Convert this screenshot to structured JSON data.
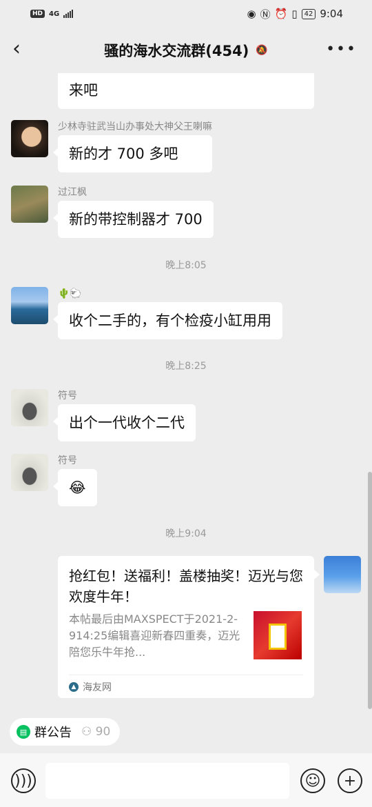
{
  "status_bar": {
    "network": "4G",
    "hd": "HD",
    "battery": "42",
    "time": "9:04"
  },
  "header": {
    "title": "骚的海水交流群(454)",
    "mute_icon": "bell-mute-icon",
    "more_icon": "more-icon"
  },
  "messages": [
    {
      "sender": "",
      "text": "来吧"
    },
    {
      "sender": "少林寺驻武当山办事处大神父王喇嘛",
      "text": "新的才 700 多吧"
    },
    {
      "sender": "过江枫",
      "text": "新的带控制器才 700"
    },
    {
      "sender": "🌵🐑",
      "text": "收个二手的，有个检疫小缸用用"
    },
    {
      "sender": "符号",
      "text": "出个一代收个二代"
    },
    {
      "sender": "符号",
      "text": "😂"
    }
  ],
  "timestamps": [
    "晚上8:05",
    "晚上8:25",
    "晚上9:04"
  ],
  "link_card": {
    "title": "抢红包！送福利！盖楼抽奖！迈光与您欢度牛年！",
    "description": "本帖最后由MAXSPECT于2021-2-914:25编辑喜迎新春四重奏，迈光陪您乐牛年抢...",
    "source": "海友网"
  },
  "group_notice": {
    "label": "群公告",
    "count": "90"
  },
  "input_bar": {
    "voice_icon": "voice-icon",
    "emoji_icon": "emoji-icon",
    "plus_icon": "plus-icon"
  }
}
